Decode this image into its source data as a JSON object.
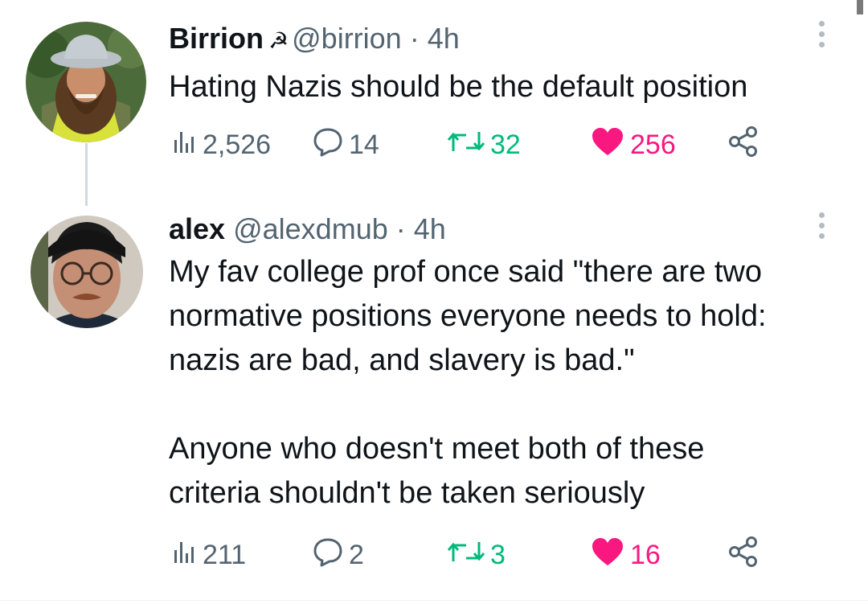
{
  "thread": [
    {
      "author": {
        "display_name": "Birrion",
        "emoji": "☭",
        "handle": "@birrion",
        "separator": "·",
        "time": "4h"
      },
      "text": "Hating Nazis should be the default position",
      "stats": {
        "views": "2,526",
        "replies": "14",
        "retweets": "32",
        "likes": "256",
        "liked": true
      }
    },
    {
      "author": {
        "display_name": "alex",
        "handle": "@alexdmub",
        "separator": "·",
        "time": "4h"
      },
      "text": "My fav college prof once said \"there are two\nnormative positions everyone needs to hold:\nnazis are bad, and slavery is bad.\"\n\nAnyone who doesn't meet both of these\ncriteria shouldn't be taken seriously",
      "stats": {
        "views": "211",
        "replies": "2",
        "retweets": "3",
        "likes": "16",
        "liked": true
      }
    }
  ],
  "icons": {
    "views": "bar-chart-icon",
    "replies": "speech-bubble-icon",
    "retweets": "retweet-arrows-icon",
    "likes": "heart-icon",
    "share": "share-nodes-icon",
    "more": "more-vertical-icon"
  },
  "colors": {
    "text_primary": "#0f1419",
    "text_secondary": "#536471",
    "retweet_green": "#00ba7c",
    "like_pink": "#f91880",
    "thread_line": "#cfd9de"
  }
}
